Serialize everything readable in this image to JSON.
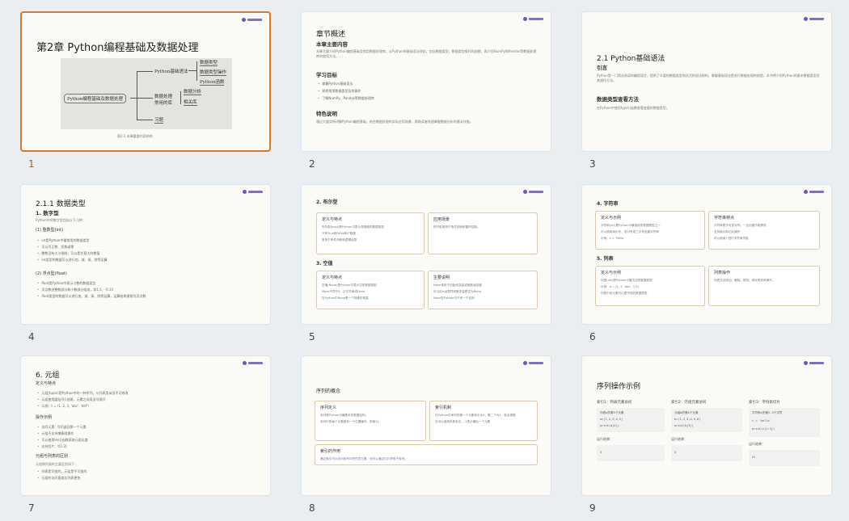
{
  "slides": [
    {
      "number": "1",
      "title": "第2章  Python编程基础及数据处理",
      "mindmap": {
        "root": "Python编程基础及数据处理",
        "branch1": "Python基础语法",
        "branch1_items": [
          "数据类型",
          "数据类型操作",
          "Python函数"
        ],
        "branch2_line1": "数据处理",
        "branch2_line2": "常用的库",
        "branch2_items": [
          "数据分析",
          "相关库"
        ],
        "branch3": "习题"
      },
      "caption": "图2-1  本章重要内容结构"
    },
    {
      "number": "2",
      "title": "章节概述",
      "subtitle": "本章主要内容",
      "intro": "本章主要介绍Python编程基础及常用数据处理库。从Python的基础语法讲起，包括数据类型、数据类型操作和函数，再介绍NumPy和Pandas等数据处理库的使用方法。",
      "section_goals": "学习目标",
      "goals": [
        "掌握Python基础语法",
        "熟悉常用数据类型及其操作",
        "了解NumPy、Pandas等数据处理库"
      ],
      "section_notes": "特色说明",
      "notes": "通过大量实例讲解Python编程基础，结合数据处理的实际应用场景，帮助读者快速掌握数据分析的基本技能。"
    },
    {
      "number": "3",
      "title": "2.1  Python基础语法",
      "subtitle": "引言",
      "intro": "Python是一门简洁易读的编程语言，提供了丰富的数据类型和灵活的语法结构。掌握基础语法是进行数据处理的前提，本节将介绍Python的基本数据类型及其操作方法。",
      "section": "数据类型查看方法",
      "section_text": "在Python中使用type()函数查看变量的数据类型。"
    },
    {
      "number": "4",
      "title": "2.1.1  数据类型",
      "subtitle": "1. 数字型",
      "intro": "Python中的数字型包括以下几种：",
      "int_title": "(1) 整数型(int)",
      "int_items": [
        "int是Python中最常用的数据类型",
        "可以为正数、负数或零",
        "整数没有大小限制，可以是任意大的数值",
        "int类型的数据可以进行加、减、乘、除等运算"
      ],
      "float_title": "(2) 浮点型(float)",
      "float_items": [
        "float是Python中表示小数的数据类型",
        "浮点数由整数部分和小数部分组成，如1.5、-0.33",
        "float类型的数据可以进行加、减、乘、除等运算，运算结果通常为浮点数"
      ]
    },
    {
      "number": "5",
      "title": "2. 布尔型",
      "box1_title": "定义与特点",
      "box1_items": [
        "布尔型(bool)是Python中表示真假值的数据类型",
        "只有True和False两个取值",
        "常用于条件判断和逻辑运算"
      ],
      "box2_title": "应用场景",
      "box2_items": [
        "布尔型常用于条件判断和循环控制。"
      ],
      "title2": "3. 空值",
      "box3_title": "定义与特点",
      "box3_items": [
        "空值(None)是Python中表示空的数据类型",
        "None不同于0、空字符串或False",
        "在Python中None是一个特殊的常量"
      ],
      "box4_title": "主要说明",
      "box4_items": [
        "None常用于初始化变量或函数返回值",
        "可以用is运算符判断变量是否为None",
        "None在Python中只有一个实例"
      ]
    },
    {
      "number": "6",
      "title": "4. 字符串",
      "box1_title": "定义与示例",
      "box1_items": [
        "字符串(str)是Python中最常用的数据类型之一",
        "可以使用单引号、双引号或三引号创建字符串",
        "示例：s = 'Hello'"
      ],
      "box2_title": "字符串特点",
      "box2_items": [
        "字符串是不可变序列，一旦创建不能修改",
        "支持索引和切片操作",
        "可以使用+进行字符串拼接"
      ],
      "title2": "5. 列表",
      "box3_title": "定义与示例",
      "box3_items": [
        "列表(list)是Python中最灵活的数据类型",
        "示例：a = [1, 2, 'abc', 3.5]",
        "列表中的元素可以是不同的数据类型"
      ],
      "box4_title": "列表操作",
      "box4_items": [
        "列表支持添加、删除、修改、排序等多种操作。"
      ]
    },
    {
      "number": "7",
      "title": "6. 元组",
      "subtitle": "定义与特点",
      "items1": [
        "元组(tuple)是Python中的一种序列，与列表类似但不可修改",
        "元组使用圆括号()创建，元素之间用逗号隔开",
        "示例：t = (1, 2, 3, 'abc', 'def')"
      ],
      "section2": "操作示例",
      "items2": [
        "访问元素：t[0]返回第一个元素",
        "元组不支持增删改操作",
        "可以使用len()函数获取元组长度",
        "支持切片：t[1:3]"
      ],
      "section3": "元组与列表的区别",
      "section3_text": "元组和列表的主要区别如下：",
      "items3": [
        "列表是可变的，元组是不可变的",
        "元组的访问速度比列表更快"
      ]
    },
    {
      "number": "8",
      "title": "序列的概念",
      "box1_title": "序列定义",
      "box1_items": [
        "序列是Python中最基本的数据结构。",
        "序列中的每个元素都有一个位置编号，即索引。"
      ],
      "box2_title": "索引机制",
      "box2_items": [
        "在Python中序列的第一个元素索引为0，第二个为1，依此类推",
        "也可以使用负数索引，-1表示最后一个元素"
      ],
      "box3_title": "索引的作用",
      "box3_items": [
        "通过索引可以访问序列中的任意元素，也可以通过切片获取子序列。"
      ]
    },
    {
      "number": "9",
      "title": "序列操作示例",
      "col1_title": "索引1：列表元素访问",
      "col1_text": "列表a的第3个元素",
      "col1_code": [
        "a=[1,2,3,4,5]",
        "print(a[2])"
      ],
      "col1_result_label": "运行结果：",
      "col1_result": "3",
      "col2_title": "索引2：元组元素访问",
      "col2_text": "元组b的第4个元素",
      "col2_code": [
        "b=(1,2,3,4,5,6)",
        "print(b[3])"
      ],
      "col2_result_label": "运行结果：",
      "col2_result": "4",
      "col3_title": "索引3：字符串切片",
      "col3_text": "字符串c的第2-3个字符",
      "col3_code": [
        "c = 'hello'",
        "print(c[1:3])"
      ],
      "col3_result_label": "运行结果：",
      "col3_result": "el"
    }
  ]
}
